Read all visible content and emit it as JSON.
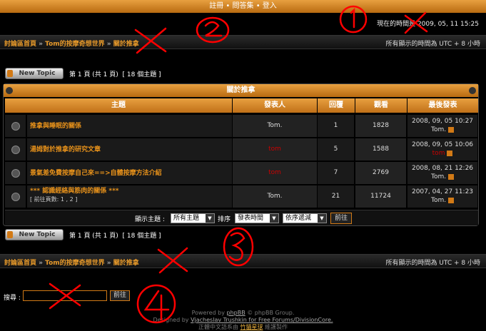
{
  "topbar": {
    "items": [
      "註冊",
      "問答集",
      "登入"
    ],
    "sep": "•"
  },
  "timeline": "現在的時間是 2009, 05, 11 15:25",
  "nav": {
    "crumbs": [
      "討論區首頁",
      "Tom的按摩奇想世界",
      "關於推拿"
    ],
    "arrow": "»",
    "tz": "所有顯示的時間為 UTC + 8 小時"
  },
  "toolbar": {
    "new_topic": "New Topic",
    "page_label": "第 1 頁 (共 1 頁)",
    "topics": "[ 18 個主題 ]"
  },
  "forum": {
    "title": "關於推拿",
    "columns": [
      "主題",
      "發表人",
      "回覆",
      "觀看",
      "最後發表"
    ],
    "rows": [
      {
        "title": "推拿與睡眠的關係",
        "pages": "",
        "author": "Tom.",
        "author_red": false,
        "replies": "1",
        "views": "1828",
        "last_date": "2008, 09, 05 10:27",
        "last_user": "Tom."
      },
      {
        "title": "湯姆對於推拿的研究文章",
        "pages": "",
        "author": "tom",
        "author_red": true,
        "replies": "5",
        "views": "1588",
        "last_date": "2008, 09, 05 10:06",
        "last_user": "tom"
      },
      {
        "title": "景氣差免費按摩自己來==>自體按摩方法介紹",
        "pages": "",
        "author": "tom",
        "author_red": true,
        "replies": "7",
        "views": "2769",
        "last_date": "2008, 08, 21 12:26",
        "last_user": "Tom."
      },
      {
        "title": "*** 認識經絡與筋肉的關係 ***",
        "pages": "[ 前往頁數: 1 , 2 ]",
        "author": "Tom.",
        "author_red": false,
        "replies": "21",
        "views": "11724",
        "last_date": "2007, 04, 27 11:23",
        "last_user": "Tom."
      }
    ]
  },
  "filter": {
    "show_label": "顯示主題 :",
    "show_value": "所有主題",
    "sort_label": "排序",
    "sort_value": "發表時間",
    "order_value": "依序遞減",
    "go": "前往"
  },
  "search": {
    "label": "搜尋 :",
    "go": "前往"
  },
  "footer": {
    "line1_pre": "Powered by ",
    "line1_link": "phpBB",
    "line1_post": " © phpBB Group.",
    "line2_pre": "Designed by ",
    "line2_link": "Vjacheslav Trushkin for Free Forums/DivisionCore.",
    "line3_pre": "正體中文語系由 ",
    "line3_link": "竹貓星球",
    "line3_post": " 維護製作"
  },
  "colors": {
    "accent": "#e8921a",
    "danger": "#cc0000",
    "annotation": "#ff0000"
  }
}
